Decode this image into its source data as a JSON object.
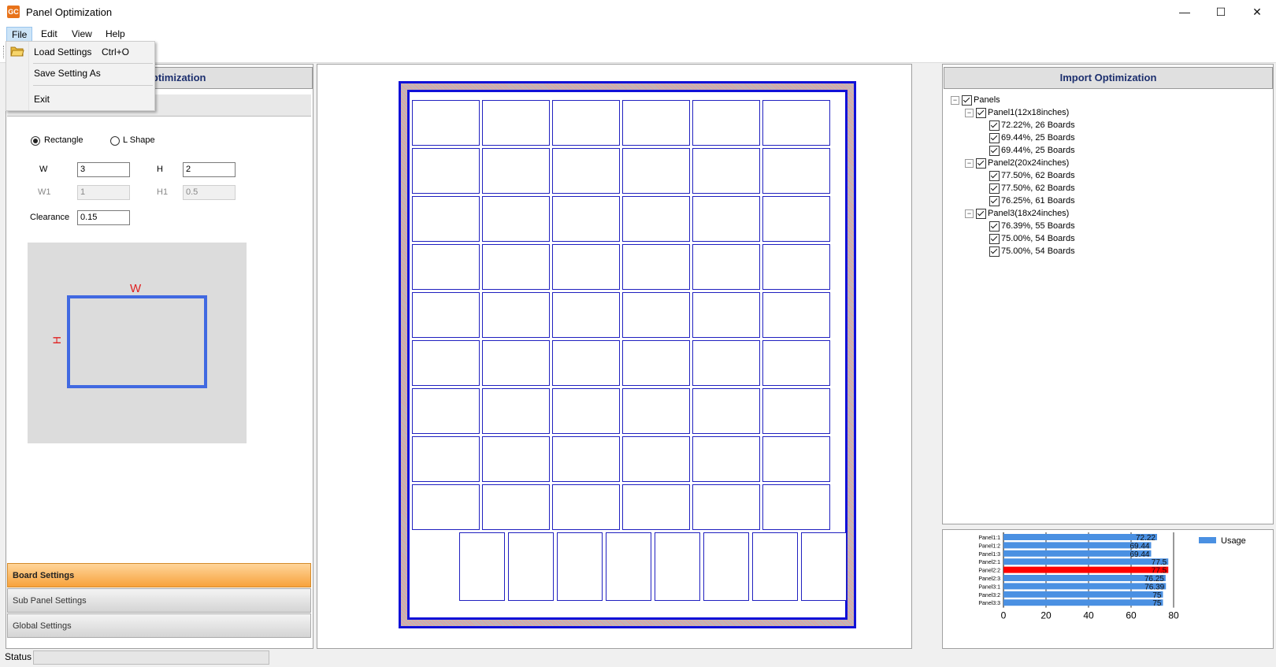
{
  "window": {
    "title": "Panel Optimization",
    "app_icon_text": "GC",
    "minimize_icon": "—",
    "maximize_icon": "☐",
    "close_icon": "✕"
  },
  "menu": {
    "items": [
      "File",
      "Edit",
      "View",
      "Help"
    ]
  },
  "file_menu": {
    "items": [
      {
        "label": "Load Settings",
        "shortcut": "Ctrl+O"
      },
      {
        "label": "Save Setting As",
        "shortcut": ""
      },
      {
        "label": "Exit",
        "shortcut": ""
      }
    ]
  },
  "left": {
    "header": "Panel Optimization",
    "section_title": "Board Settings",
    "shape_options": [
      {
        "label": "Rectangle",
        "selected": true
      },
      {
        "label": "L Shape",
        "selected": false
      }
    ],
    "fields": {
      "w": {
        "label": "W",
        "value": "3"
      },
      "h": {
        "label": "H",
        "value": "2"
      },
      "w1": {
        "label": "W1",
        "value": "1"
      },
      "h1": {
        "label": "H1",
        "value": "0.5"
      },
      "clearance": {
        "label": "Clearance",
        "value": "0.15"
      }
    },
    "preview": {
      "w_label": "W",
      "h_label": "H"
    },
    "accordion": [
      "Board Settings",
      "Sub Panel Settings",
      "Global Settings"
    ]
  },
  "layout": {
    "grid_rows": 9,
    "grid_cols": 6,
    "bottom_row_count": 8
  },
  "right": {
    "header": "Import Optimization",
    "tree": {
      "root": "Panels",
      "groups": [
        {
          "label": "Panel1(12x18inches)",
          "children": [
            "72.22%, 26 Boards",
            "69.44%, 25 Boards",
            "69.44%, 25 Boards"
          ]
        },
        {
          "label": "Panel2(20x24inches)",
          "children": [
            "77.50%, 62 Boards",
            "77.50%, 62 Boards",
            "76.25%, 61 Boards"
          ]
        },
        {
          "label": "Panel3(18x24inches)",
          "children": [
            "76.39%, 55 Boards",
            "75.00%, 54 Boards",
            "75.00%, 54 Boards"
          ]
        }
      ]
    }
  },
  "chart_data": {
    "type": "bar",
    "orientation": "horizontal",
    "categories": [
      "Panel1:1",
      "Panel1:2",
      "Panel1:3",
      "Panel2:1",
      "Panel2:2",
      "Panel2:3",
      "Panel3:1",
      "Panel3:2",
      "Panel3:3"
    ],
    "value_labels": [
      "72.22",
      "69.44",
      "69.44",
      "77.5",
      "77.5",
      "76.25",
      "76.39",
      "75",
      "75"
    ],
    "series": [
      {
        "name": "Usage",
        "values": [
          72.22,
          69.44,
          69.44,
          77.5,
          77.5,
          76.25,
          76.39,
          75,
          75
        ]
      }
    ],
    "highlight_index": 4,
    "xlim": [
      0,
      80
    ],
    "x_ticks": [
      "0",
      "20",
      "40",
      "60",
      "80"
    ],
    "legend_position": "top-right",
    "colors": {
      "bar": "#4a90e2",
      "highlight": "#ff0000"
    }
  },
  "status": {
    "label": "Status"
  }
}
